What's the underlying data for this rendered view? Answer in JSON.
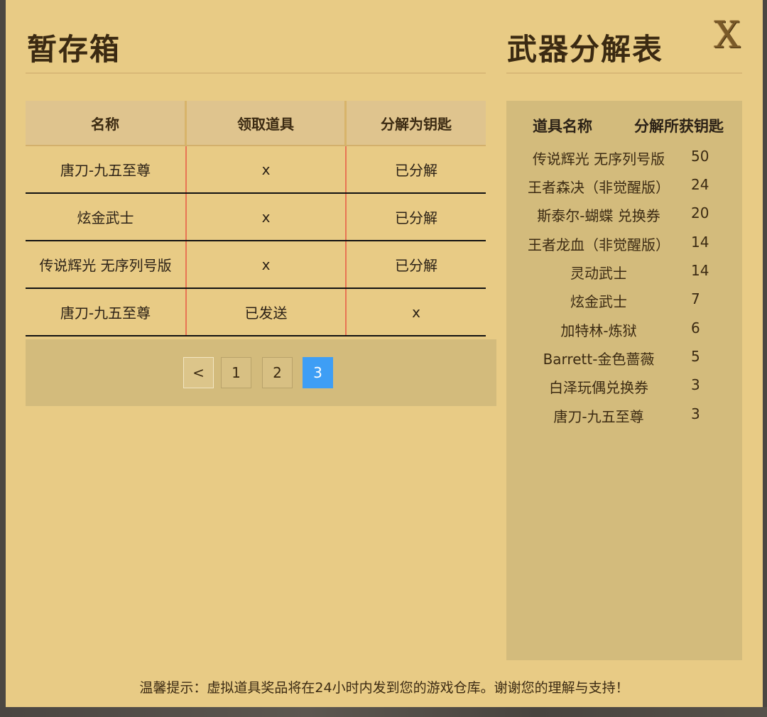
{
  "stash": {
    "title": "暂存箱",
    "headers": [
      "名称",
      "领取道具",
      "分解为钥匙"
    ],
    "rows": [
      [
        "唐刀-九五至尊",
        "x",
        "已分解"
      ],
      [
        "炫金武士",
        "x",
        "已分解"
      ],
      [
        "传说辉光 无序列号版",
        "x",
        "已分解"
      ],
      [
        "唐刀-九五至尊",
        "已发送",
        "x"
      ]
    ],
    "pager": {
      "prev": "<",
      "pages": [
        "1",
        "2",
        "3"
      ],
      "current": "3"
    }
  },
  "decompose": {
    "title": "武器分解表",
    "headers": [
      "道具名称",
      "分解所获钥匙"
    ],
    "rows": [
      [
        "传说辉光 无序列号版",
        "50"
      ],
      [
        "王者森决（非觉醒版）",
        "24"
      ],
      [
        "斯泰尔-蝴蝶 兑换券",
        "20"
      ],
      [
        "王者龙血（非觉醒版）",
        "14"
      ],
      [
        "灵动武士",
        "14"
      ],
      [
        "炫金武士",
        "7"
      ],
      [
        "加特林-炼狱",
        "6"
      ],
      [
        "Barrett-金色蔷薇",
        "5"
      ],
      [
        "白泽玩偶兑换券",
        "3"
      ],
      [
        "唐刀-九五至尊",
        "3"
      ]
    ]
  },
  "close": {
    "label": "X",
    "icon": "close-icon"
  },
  "notice": "温馨提示：虚拟道具奖品将在24小时内发到您的游戏仓库。谢谢您的理解与支持！",
  "colors": {
    "panel": "#e8cb85",
    "active_page": "#3e9ef5",
    "row_divider": "#e87454"
  }
}
